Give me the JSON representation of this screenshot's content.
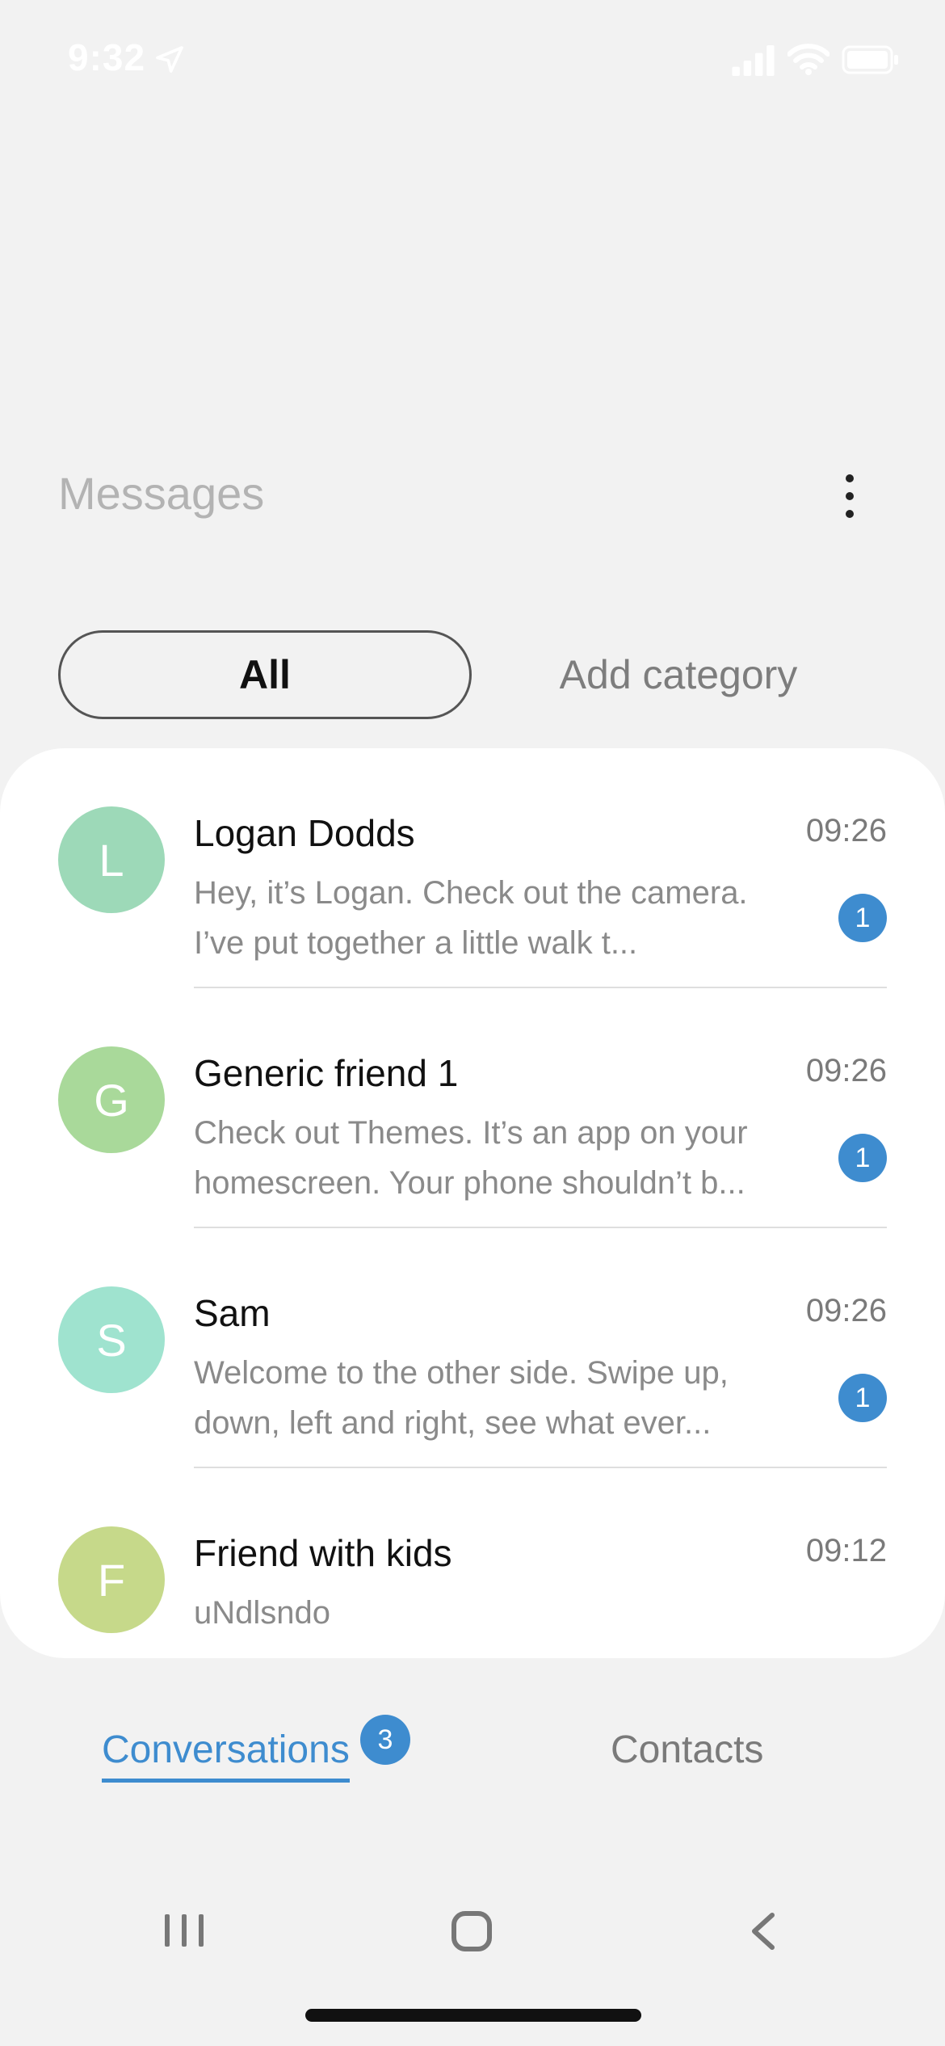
{
  "status_bar": {
    "time": "9:32",
    "icons": [
      "location-arrow-icon",
      "signal-icon",
      "wifi-icon",
      "battery-icon"
    ]
  },
  "header": {
    "title": "Messages",
    "more_icon": "more-vertical-icon"
  },
  "categories": {
    "selected": "All",
    "add": "Add category"
  },
  "conversations": [
    {
      "initial": "L",
      "name": "Logan Dodds",
      "time": "09:26",
      "preview": "Hey, it’s Logan. Check out the camera. I’ve put together a little walk t...",
      "unread": "1",
      "avatar_color": "#9dd9b8"
    },
    {
      "initial": "G",
      "name": "Generic friend 1",
      "time": "09:26",
      "preview": "Check out Themes. It’s an app on your homescreen. Your phone shouldn’t b...",
      "unread": "1",
      "avatar_color": "#a9d99a"
    },
    {
      "initial": "S",
      "name": "Sam",
      "time": "09:26",
      "preview": "Welcome to the other side. Swipe up, down, left and right, see what ever...",
      "unread": "1",
      "avatar_color": "#9fe3cf"
    },
    {
      "initial": "F",
      "name": "Friend with kids",
      "time": "09:12",
      "preview": "uNdlsndo",
      "unread": "",
      "avatar_color": "#c6d98a"
    }
  ],
  "tabs": {
    "conversations": "Conversations",
    "conversations_badge": "3",
    "contacts": "Contacts"
  },
  "colors": {
    "accent": "#3e8ccf",
    "background": "#f2f2f2",
    "card": "#ffffff"
  },
  "system_nav": [
    "recents-icon",
    "home-icon",
    "back-icon"
  ]
}
